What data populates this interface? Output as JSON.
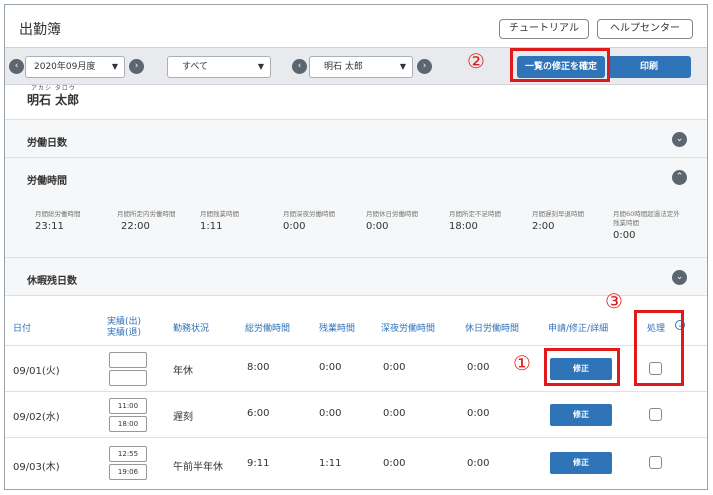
{
  "header": {
    "title": "出勤簿",
    "tutorial_label": "チュートリアル",
    "help_label": "ヘルプセンター"
  },
  "toolbar": {
    "month_value": "2020年09月度",
    "filter_value": "すべて",
    "person_value": "明石 太郎",
    "confirm_label": "一覧の修正を確定",
    "print_label": "印刷",
    "prev_glyph": "‹",
    "next_glyph": "›",
    "dropdown_glyph": "▼"
  },
  "employee": {
    "kana": "アカシ タロウ",
    "name": "明石 太郎"
  },
  "sections": {
    "work_days": "労働日数",
    "work_hours": "労働時間",
    "leave_days": "休暇残日数"
  },
  "work_stats": [
    {
      "label": "月間総労働時間",
      "value": "23:11"
    },
    {
      "label": "月間所定内労働時間",
      "value": "22:00"
    },
    {
      "label": "月間残業時間",
      "value": "1:11"
    },
    {
      "label": "月間深夜労働時間",
      "value": "0:00"
    },
    {
      "label": "月間休日労働時間",
      "value": "0:00"
    },
    {
      "label": "月間所定不足時間",
      "value": "18:00"
    },
    {
      "label": "月間遅刻早退時間",
      "value": "2:00"
    },
    {
      "label": "月間60時間超過法定外残業時間",
      "value": "0:00"
    }
  ],
  "table": {
    "headers": {
      "date": "日付",
      "actual_in": "実績(出)",
      "actual_out": "実績(退)",
      "status": "勤務状況",
      "total": "総労働時間",
      "overtime": "残業時間",
      "night": "深夜労働時間",
      "holiday": "休日労働時間",
      "request": "申請/修正/詳細",
      "process": "処理"
    },
    "fix_label": "修正",
    "rows": [
      {
        "date": "09/01(火)",
        "in": "",
        "out": "",
        "status": "年休",
        "total": "8:00",
        "overtime": "0:00",
        "night": "0:00",
        "holiday": "0:00"
      },
      {
        "date": "09/02(水)",
        "in": "11:00",
        "out": "18:00",
        "status": "遅刻",
        "total": "6:00",
        "overtime": "0:00",
        "night": "0:00",
        "holiday": "0:00"
      },
      {
        "date": "09/03(木)",
        "in": "12:55",
        "out": "19:06",
        "status": "午前半年休",
        "total": "9:11",
        "overtime": "1:11",
        "night": "0:00",
        "holiday": "0:00"
      }
    ]
  },
  "annotations": {
    "n1": "①",
    "n2": "②",
    "n3": "③"
  },
  "colors": {
    "primary": "#2f73b8",
    "annotation": "#e01a1a",
    "toolbar_bg": "#e8eaed"
  }
}
